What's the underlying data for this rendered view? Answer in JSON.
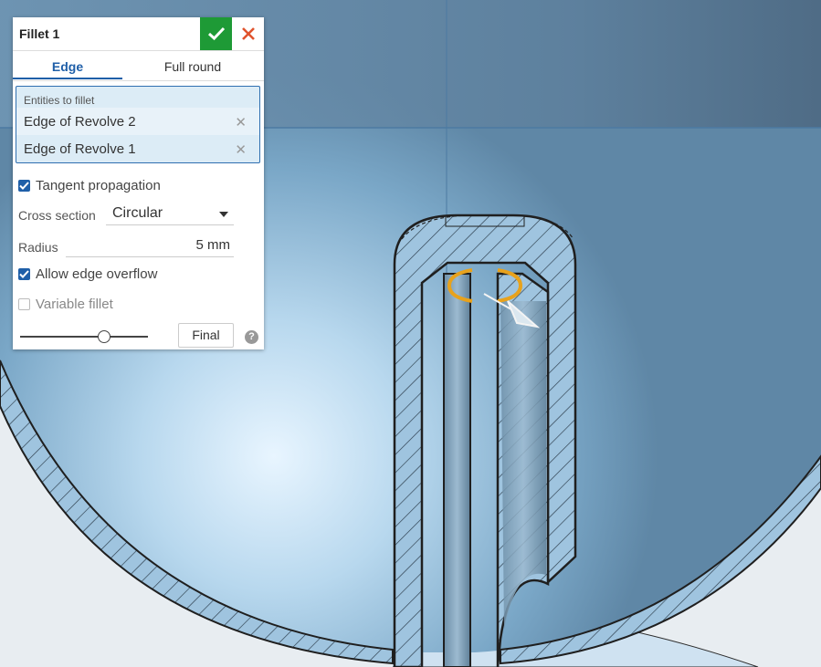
{
  "dialog": {
    "title": "Fillet 1",
    "confirm_icon": "checkmark-icon",
    "cancel_icon": "close-icon",
    "accent_color": "#1e9a36",
    "cancel_color": "#e0532d",
    "tabs": [
      {
        "label": "Edge",
        "active": true
      },
      {
        "label": "Full round",
        "active": false
      }
    ],
    "entities": {
      "label": "Entities to fillet",
      "items": [
        "Edge of Revolve 2",
        "Edge of Revolve 1"
      ]
    },
    "tangent_propagation": {
      "label": "Tangent propagation",
      "checked": true
    },
    "cross_section": {
      "label": "Cross section",
      "value": "Circular"
    },
    "radius": {
      "label": "Radius",
      "value": "5 mm"
    },
    "allow_edge_overflow": {
      "label": "Allow edge overflow",
      "checked": true
    },
    "variable_fillet": {
      "label": "Variable fillet",
      "checked": false
    },
    "preview_slider": {
      "position": 0.65
    },
    "final_button": "Final",
    "help_icon": "help-icon",
    "help_glyph": "?"
  }
}
